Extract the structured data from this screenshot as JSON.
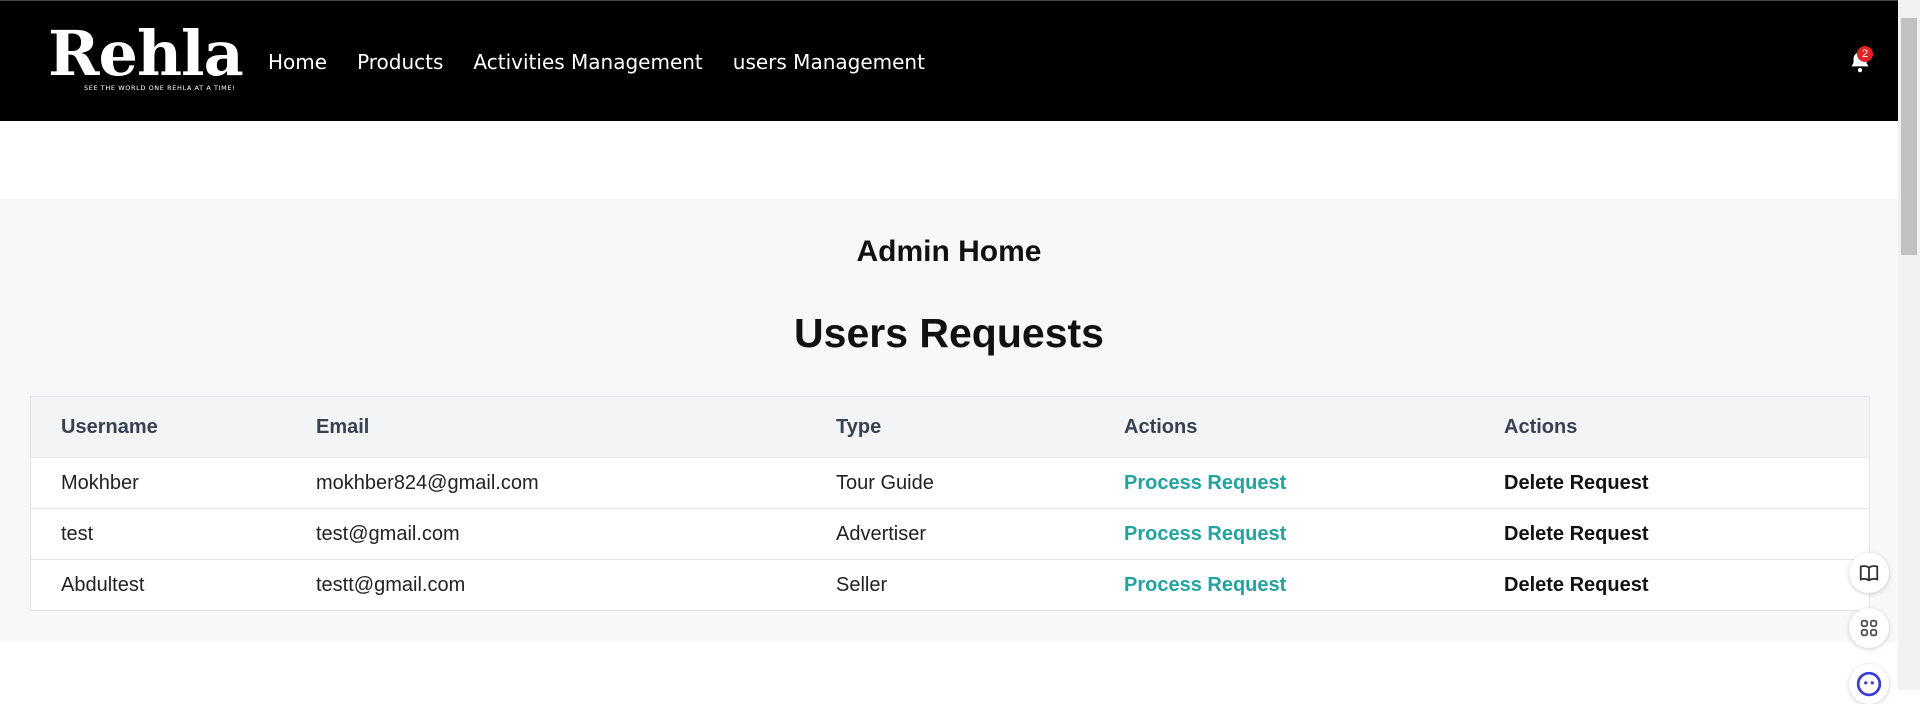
{
  "brand": {
    "name": "Rehla",
    "tagline": "SEE THE WORLD ONE REHLA AT A TIME!"
  },
  "nav": {
    "items": [
      "Home",
      "Products",
      "Activities Management",
      "users Management"
    ]
  },
  "notifications": {
    "count": "2"
  },
  "main": {
    "title": "Admin Home",
    "section_title": "Users Requests",
    "table": {
      "headers": [
        "Username",
        "Email",
        "Type",
        "Actions",
        "Actions"
      ],
      "rows": [
        {
          "username": "Mokhber",
          "email": "mokhber824@gmail.com",
          "type": "Tour Guide",
          "process": "Process Request",
          "delete": "Delete Request"
        },
        {
          "username": "test",
          "email": "test@gmail.com",
          "type": "Advertiser",
          "process": "Process Request",
          "delete": "Delete Request"
        },
        {
          "username": "Abdultest",
          "email": "testt@gmail.com",
          "type": "Seller",
          "process": "Process Request",
          "delete": "Delete Request"
        }
      ]
    }
  },
  "colors": {
    "header_bg": "#000000",
    "accent": "#22a39f",
    "badge": "#e02424"
  },
  "floating_icons": [
    "book-icon",
    "command-icon",
    "assistant-icon"
  ]
}
